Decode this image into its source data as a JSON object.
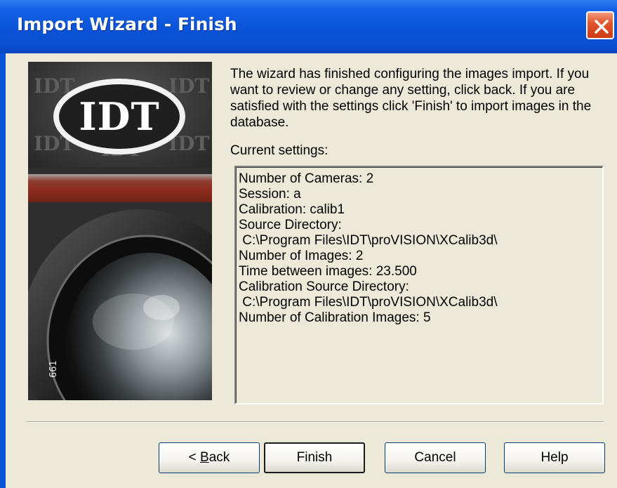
{
  "window": {
    "title": "Import Wizard - Finish",
    "close_icon": "close-x-icon"
  },
  "banner": {
    "logo_text": "IDT",
    "bg_logo_text": "IDT",
    "lens_engraving": "661"
  },
  "intro": {
    "text": "The wizard has finished configuring the images import. If you want to review or change any setting, click back. If you are satisfied with the settings click 'Finish' to import images in the database."
  },
  "settings": {
    "label": "Current settings:",
    "lines": [
      "Number of Cameras: 2",
      "Session: a",
      "Calibration: calib1",
      "Source Directory:",
      " C:\\Program Files\\IDT\\proVISION\\XCalib3d\\",
      "Number of Images: 2",
      "Time between images: 23.500",
      "Calibration Source Directory:",
      " C:\\Program Files\\IDT\\proVISION\\XCalib3d\\",
      "Number of Calibration Images: 5"
    ]
  },
  "buttons": {
    "back_prefix": "< ",
    "back_underlined": "B",
    "back_rest": "ack",
    "finish": "Finish",
    "cancel": "Cancel",
    "help": "Help"
  },
  "colors": {
    "titlebar": "#0a53d6",
    "dialog_bg": "#ece9d8",
    "close_button": "#e3572d",
    "banner_stripe": "#8b2a1c"
  }
}
